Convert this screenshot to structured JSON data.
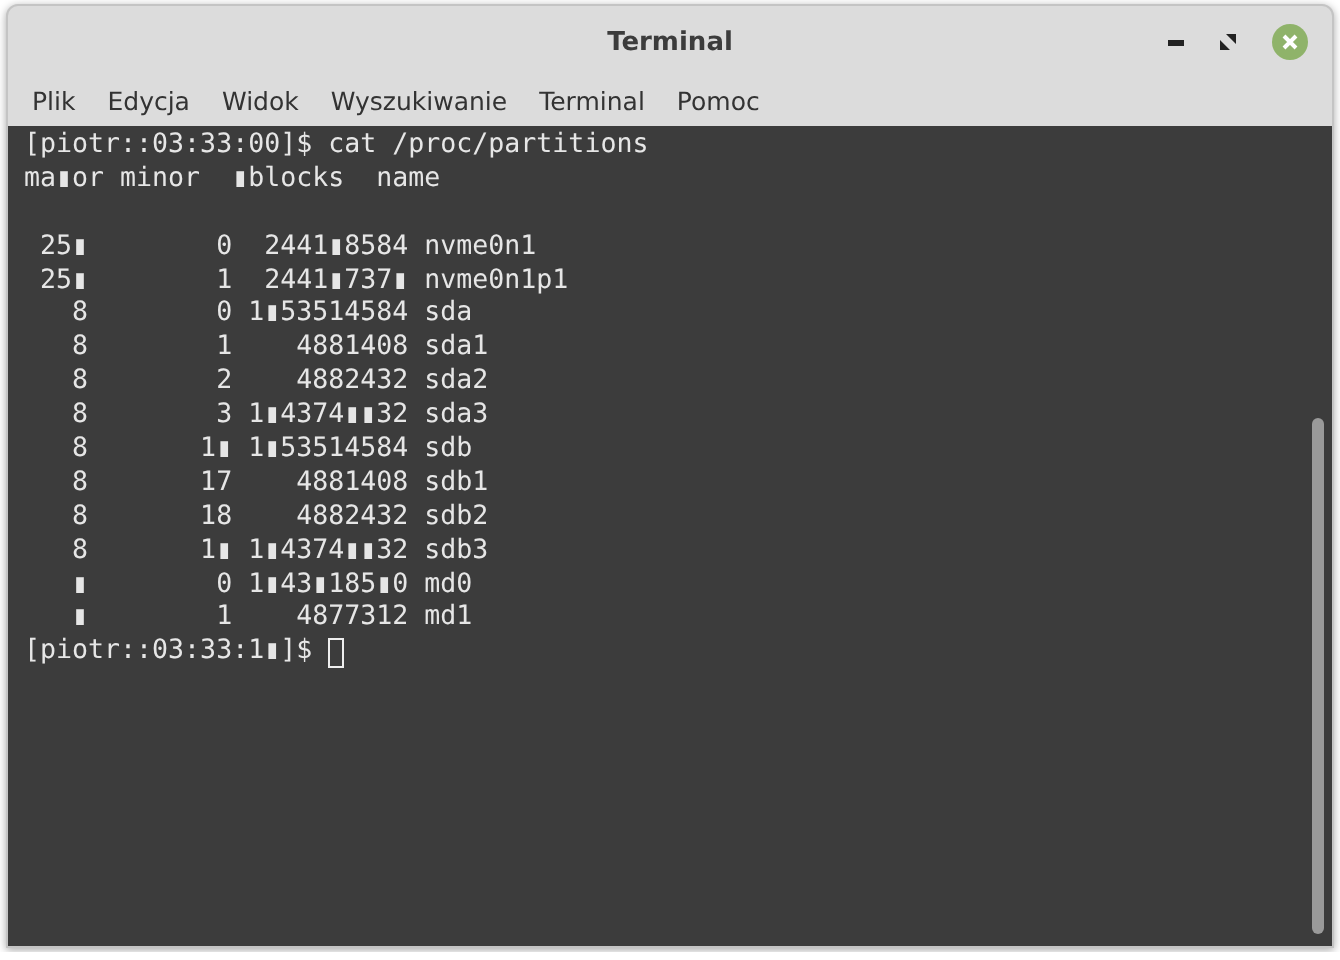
{
  "window": {
    "title": "Terminal"
  },
  "menu": [
    "Plik",
    "Edycja",
    "Widok",
    "Wyszukiwanie",
    "Terminal",
    "Pomoc"
  ],
  "terminal": {
    "lines": [
      {
        "kind": "output",
        "text": "[piotr::03:33:00]$ cat /proc/partitions"
      },
      {
        "kind": "output",
        "text": "ma▮or minor  ▮blocks  name"
      },
      {
        "kind": "blank"
      },
      {
        "kind": "output",
        "text": " 25▮        0  2441▮8584 nvme0n1"
      },
      {
        "kind": "output",
        "text": " 25▮        1  2441▮737▮ nvme0n1p1"
      },
      {
        "kind": "output",
        "text": "   8        0 1▮53514584 sda"
      },
      {
        "kind": "output",
        "text": "   8        1    4881408 sda1"
      },
      {
        "kind": "output",
        "text": "   8        2    4882432 sda2"
      },
      {
        "kind": "output",
        "text": "   8        3 1▮4374▮▮32 sda3"
      },
      {
        "kind": "output",
        "text": "   8       1▮ 1▮53514584 sdb"
      },
      {
        "kind": "output",
        "text": "   8       17    4881408 sdb1"
      },
      {
        "kind": "output",
        "text": "   8       18    4882432 sdb2"
      },
      {
        "kind": "output",
        "text": "   8       1▮ 1▮4374▮▮32 sdb3"
      },
      {
        "kind": "output",
        "text": "   ▮        0 1▮43▮185▮0 md0"
      },
      {
        "kind": "output",
        "text": "   ▮        1    4877312 md1"
      },
      {
        "kind": "prompt",
        "text": "[piotr::03:33:1▮]$"
      }
    ]
  }
}
